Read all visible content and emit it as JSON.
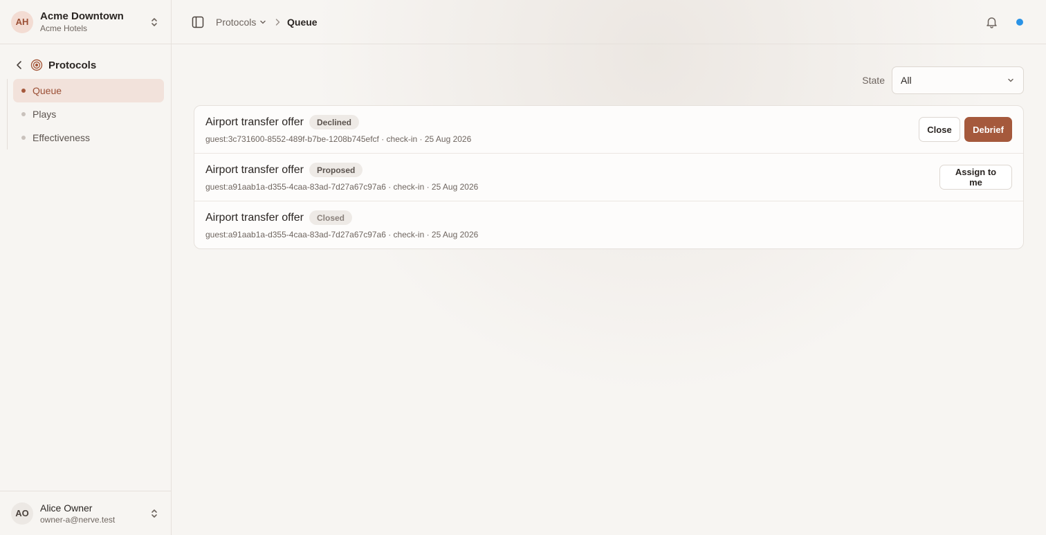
{
  "org": {
    "initials": "AH",
    "name": "Acme Downtown",
    "subtitle": "Acme Hotels"
  },
  "sidebar": {
    "back_label": "Protocols",
    "items": [
      {
        "label": "Queue",
        "active": true
      },
      {
        "label": "Plays",
        "active": false
      },
      {
        "label": "Effectiveness",
        "active": false
      }
    ]
  },
  "user": {
    "initials": "AO",
    "name": "Alice Owner",
    "email": "owner-a@nerve.test"
  },
  "breadcrumb": {
    "parent": "Protocols",
    "current": "Queue"
  },
  "filter": {
    "label": "State",
    "value": "All"
  },
  "rows": [
    {
      "title": "Airport transfer offer",
      "status": "Declined",
      "meta": "guest:3c731600-8552-489f-b7be-1208b745efcf · check-in · 25 Aug 2026",
      "actions": [
        "Close",
        "Debrief"
      ]
    },
    {
      "title": "Airport transfer offer",
      "status": "Proposed",
      "meta": "guest:a91aab1a-d355-4caa-83ad-7d27a67c97a6 · check-in · 25 Aug 2026",
      "actions": [
        "Assign to me"
      ]
    },
    {
      "title": "Airport transfer offer",
      "status": "Closed",
      "meta": "guest:a91aab1a-d355-4caa-83ad-7d27a67c97a6 · check-in · 25 Aug 2026",
      "actions": []
    }
  ],
  "colors": {
    "accent": "#a5593c",
    "status_dot": "#2a93e6"
  }
}
